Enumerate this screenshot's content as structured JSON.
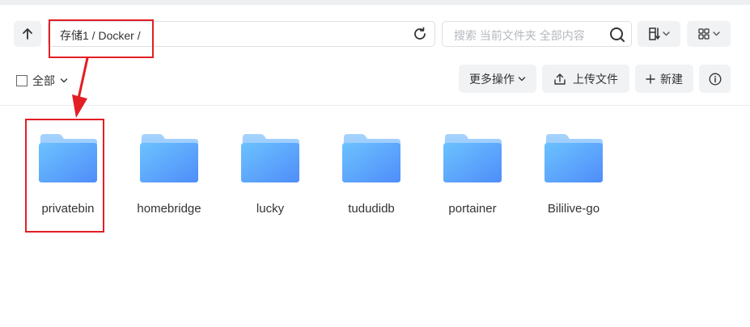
{
  "toolbar": {
    "breadcrumb": "存储1 / Docker /",
    "search_placeholder": "搜索 当前文件夹 全部内容",
    "up_icon": "arrow-up-icon",
    "refresh_icon": "refresh-icon",
    "sort_icon": "sort-icon",
    "view_icon": "grid-view-icon"
  },
  "actions": {
    "select_all": "全部",
    "more": "更多操作",
    "upload": "上传文件",
    "new": "新建",
    "info_icon": "info-icon"
  },
  "folders": [
    {
      "name": "privatebin"
    },
    {
      "name": "homebridge"
    },
    {
      "name": "lucky"
    },
    {
      "name": "tududidb"
    },
    {
      "name": "portainer"
    },
    {
      "name": "Bililive-go"
    }
  ],
  "colors": {
    "annotation": "#e31e24",
    "folder_front": "#5aa8fb",
    "folder_back": "#8fc6fd",
    "button_bg": "#f1f2f4"
  }
}
